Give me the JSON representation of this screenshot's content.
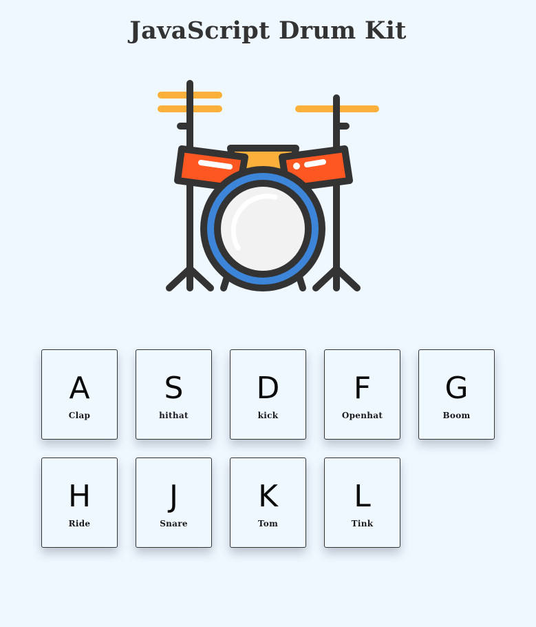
{
  "page": {
    "title": "JavaScript Drum Kit"
  },
  "illustration": {
    "icon": "drum-kit-icon",
    "colors": {
      "outline": "#333333",
      "cymbal": "#fbb03b",
      "tom": "#ff5722",
      "snare_top": "#fbb03b",
      "bass_ring": "#3d85d8",
      "bass_head": "#f2f2f2"
    }
  },
  "pads": [
    {
      "key": "A",
      "sound": "Clap"
    },
    {
      "key": "S",
      "sound": "hithat"
    },
    {
      "key": "D",
      "sound": "kick"
    },
    {
      "key": "F",
      "sound": "Openhat"
    },
    {
      "key": "G",
      "sound": "Boom"
    },
    {
      "key": "H",
      "sound": "Ride"
    },
    {
      "key": "J",
      "sound": "Snare"
    },
    {
      "key": "K",
      "sound": "Tom"
    },
    {
      "key": "L",
      "sound": "Tink"
    }
  ],
  "theme": {
    "background": "#eff7ff",
    "text": "#333333"
  }
}
